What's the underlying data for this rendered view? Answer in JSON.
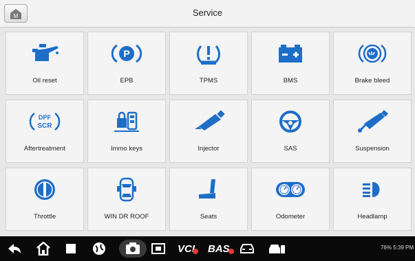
{
  "header": {
    "title": "Service",
    "home_icon": "home-icon"
  },
  "tiles": [
    {
      "label": "Oil reset",
      "icon": "oil-can-icon"
    },
    {
      "label": "EPB",
      "icon": "parking-brake-icon"
    },
    {
      "label": "TPMS",
      "icon": "tire-pressure-icon"
    },
    {
      "label": "BMS",
      "icon": "battery-icon"
    },
    {
      "label": "Brake bleed",
      "icon": "brake-disc-icon"
    },
    {
      "label": "Aftertreatment",
      "icon": "dpf-scr-icon"
    },
    {
      "label": "Immo keys",
      "icon": "immo-key-icon"
    },
    {
      "label": "Injector",
      "icon": "injector-icon"
    },
    {
      "label": "SAS",
      "icon": "steering-wheel-icon"
    },
    {
      "label": "Suspension",
      "icon": "shock-absorber-icon"
    },
    {
      "label": "Throttle",
      "icon": "throttle-icon"
    },
    {
      "label": "WIN DR ROOF",
      "icon": "car-windows-icon"
    },
    {
      "label": "Seats",
      "icon": "seat-icon"
    },
    {
      "label": "Odometer",
      "icon": "odometer-icon"
    },
    {
      "label": "Headlamp",
      "icon": "headlamp-icon"
    }
  ],
  "dpf_text": {
    "top": "DPF",
    "bottom": "SCR"
  },
  "navbar": {
    "vci_label": "VCI",
    "bas_label": "BAS",
    "status_text": "76% 5:39 PM"
  },
  "colors": {
    "icon_blue": "#1e6ec8",
    "header_bg": "#f2f2f2",
    "navbar_bg": "#0a0a0a"
  }
}
